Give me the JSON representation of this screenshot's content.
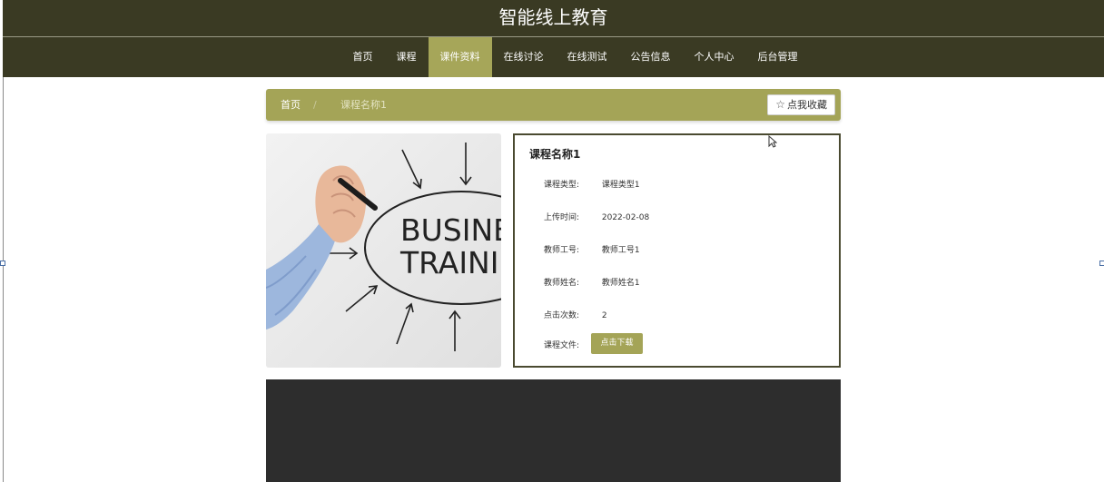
{
  "site": {
    "title": "智能线上教育"
  },
  "nav": {
    "items": [
      {
        "label": "首页"
      },
      {
        "label": "课程"
      },
      {
        "label": "课件资料"
      },
      {
        "label": "在线讨论"
      },
      {
        "label": "在线测试"
      },
      {
        "label": "公告信息"
      },
      {
        "label": "个人中心"
      },
      {
        "label": "后台管理"
      }
    ],
    "active_index": 2
  },
  "breadcrumb": {
    "home": "首页",
    "separator": "/",
    "current": "课程名称1"
  },
  "favorite_button": {
    "label": "点我收藏",
    "icon": "star-outline-icon"
  },
  "course_image": {
    "text_line1": "BUSINES",
    "text_line2": "TRAININ"
  },
  "course": {
    "title": "课程名称1",
    "fields": [
      {
        "label": "课程类型:",
        "value": "课程类型1"
      },
      {
        "label": "上传时间:",
        "value": "2022-02-08"
      },
      {
        "label": "教师工号:",
        "value": "教师工号1"
      },
      {
        "label": "教师姓名:",
        "value": "教师姓名1"
      },
      {
        "label": "点击次数:",
        "value": "2"
      }
    ],
    "file_label": "课程文件:",
    "download_label": "点击下载"
  },
  "colors": {
    "header_bg": "#3a3a23",
    "accent": "#a4a457",
    "card_border": "#4a4a30",
    "footer_bg": "#2d2d2d"
  }
}
